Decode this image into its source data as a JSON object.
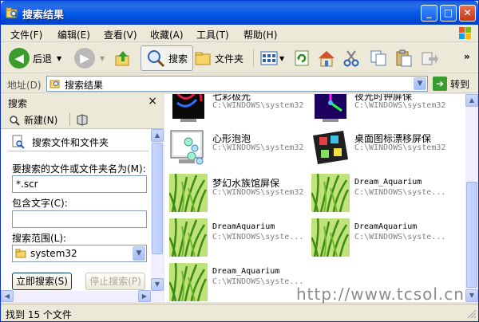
{
  "window": {
    "title": "搜索结果"
  },
  "menu": [
    "文件(F)",
    "编辑(E)",
    "查看(V)",
    "收藏(A)",
    "工具(T)",
    "帮助(H)"
  ],
  "toolbar": {
    "back_label": "后退",
    "search_label": "搜索",
    "folders_label": "文件夹"
  },
  "address": {
    "label": "地址(D)",
    "value": "搜索结果",
    "go_label": "转到"
  },
  "search_pane": {
    "title": "搜索",
    "new_label": "新建(N)",
    "heading": "搜索文件和文件夹",
    "name_label": "要搜索的文件或文件夹名为(M):",
    "name_value": "*.scr",
    "text_label": "包含文字(C):",
    "text_value": "",
    "scope_label": "搜索范围(L):",
    "scope_value": "system32",
    "search_now_label": "立即搜索(S)",
    "stop_label": "停止搜索(P)"
  },
  "results": [
    {
      "name": "七彩极光",
      "path": "C:\\WINDOWS\\system32",
      "thumb": "aurora-thumb"
    },
    {
      "name": "夜光时钟屏保",
      "path": "C:\\WINDOWS\\system32",
      "thumb": "clock-thumb"
    },
    {
      "name": "心形泡泡",
      "path": "C:\\WINDOWS\\system32",
      "thumb": "bubbles-thumb"
    },
    {
      "name": "桌面图标漂移屏保",
      "path": "C:\\WINDOWS\\system32",
      "thumb": "icons-thumb"
    },
    {
      "name": "梦幻水族馆屏保",
      "path": "C:\\WINDOWS\\system32",
      "thumb": "grass-thumb"
    },
    {
      "name": "Dream_Aquarium",
      "path": "C:\\WINDOWS\\syste...",
      "thumb": "grass-thumb"
    },
    {
      "name": "DreamAquarium",
      "path": "C:\\WINDOWS\\syste...",
      "thumb": "grass-thumb"
    },
    {
      "name": "DreamAquarium",
      "path": "C:\\WINDOWS\\syste...",
      "thumb": "grass-thumb"
    },
    {
      "name": "Dream_Aquarium",
      "path": "C:\\WINDOWS\\syste...",
      "thumb": "grass-thumb"
    }
  ],
  "status": {
    "text": "找到 15 个文件"
  },
  "watermark": "http://www.tcsol.cn",
  "colors": {
    "title_bar": "#0055e5",
    "go_green": "#3b9c2e",
    "border": "#0831d9"
  }
}
